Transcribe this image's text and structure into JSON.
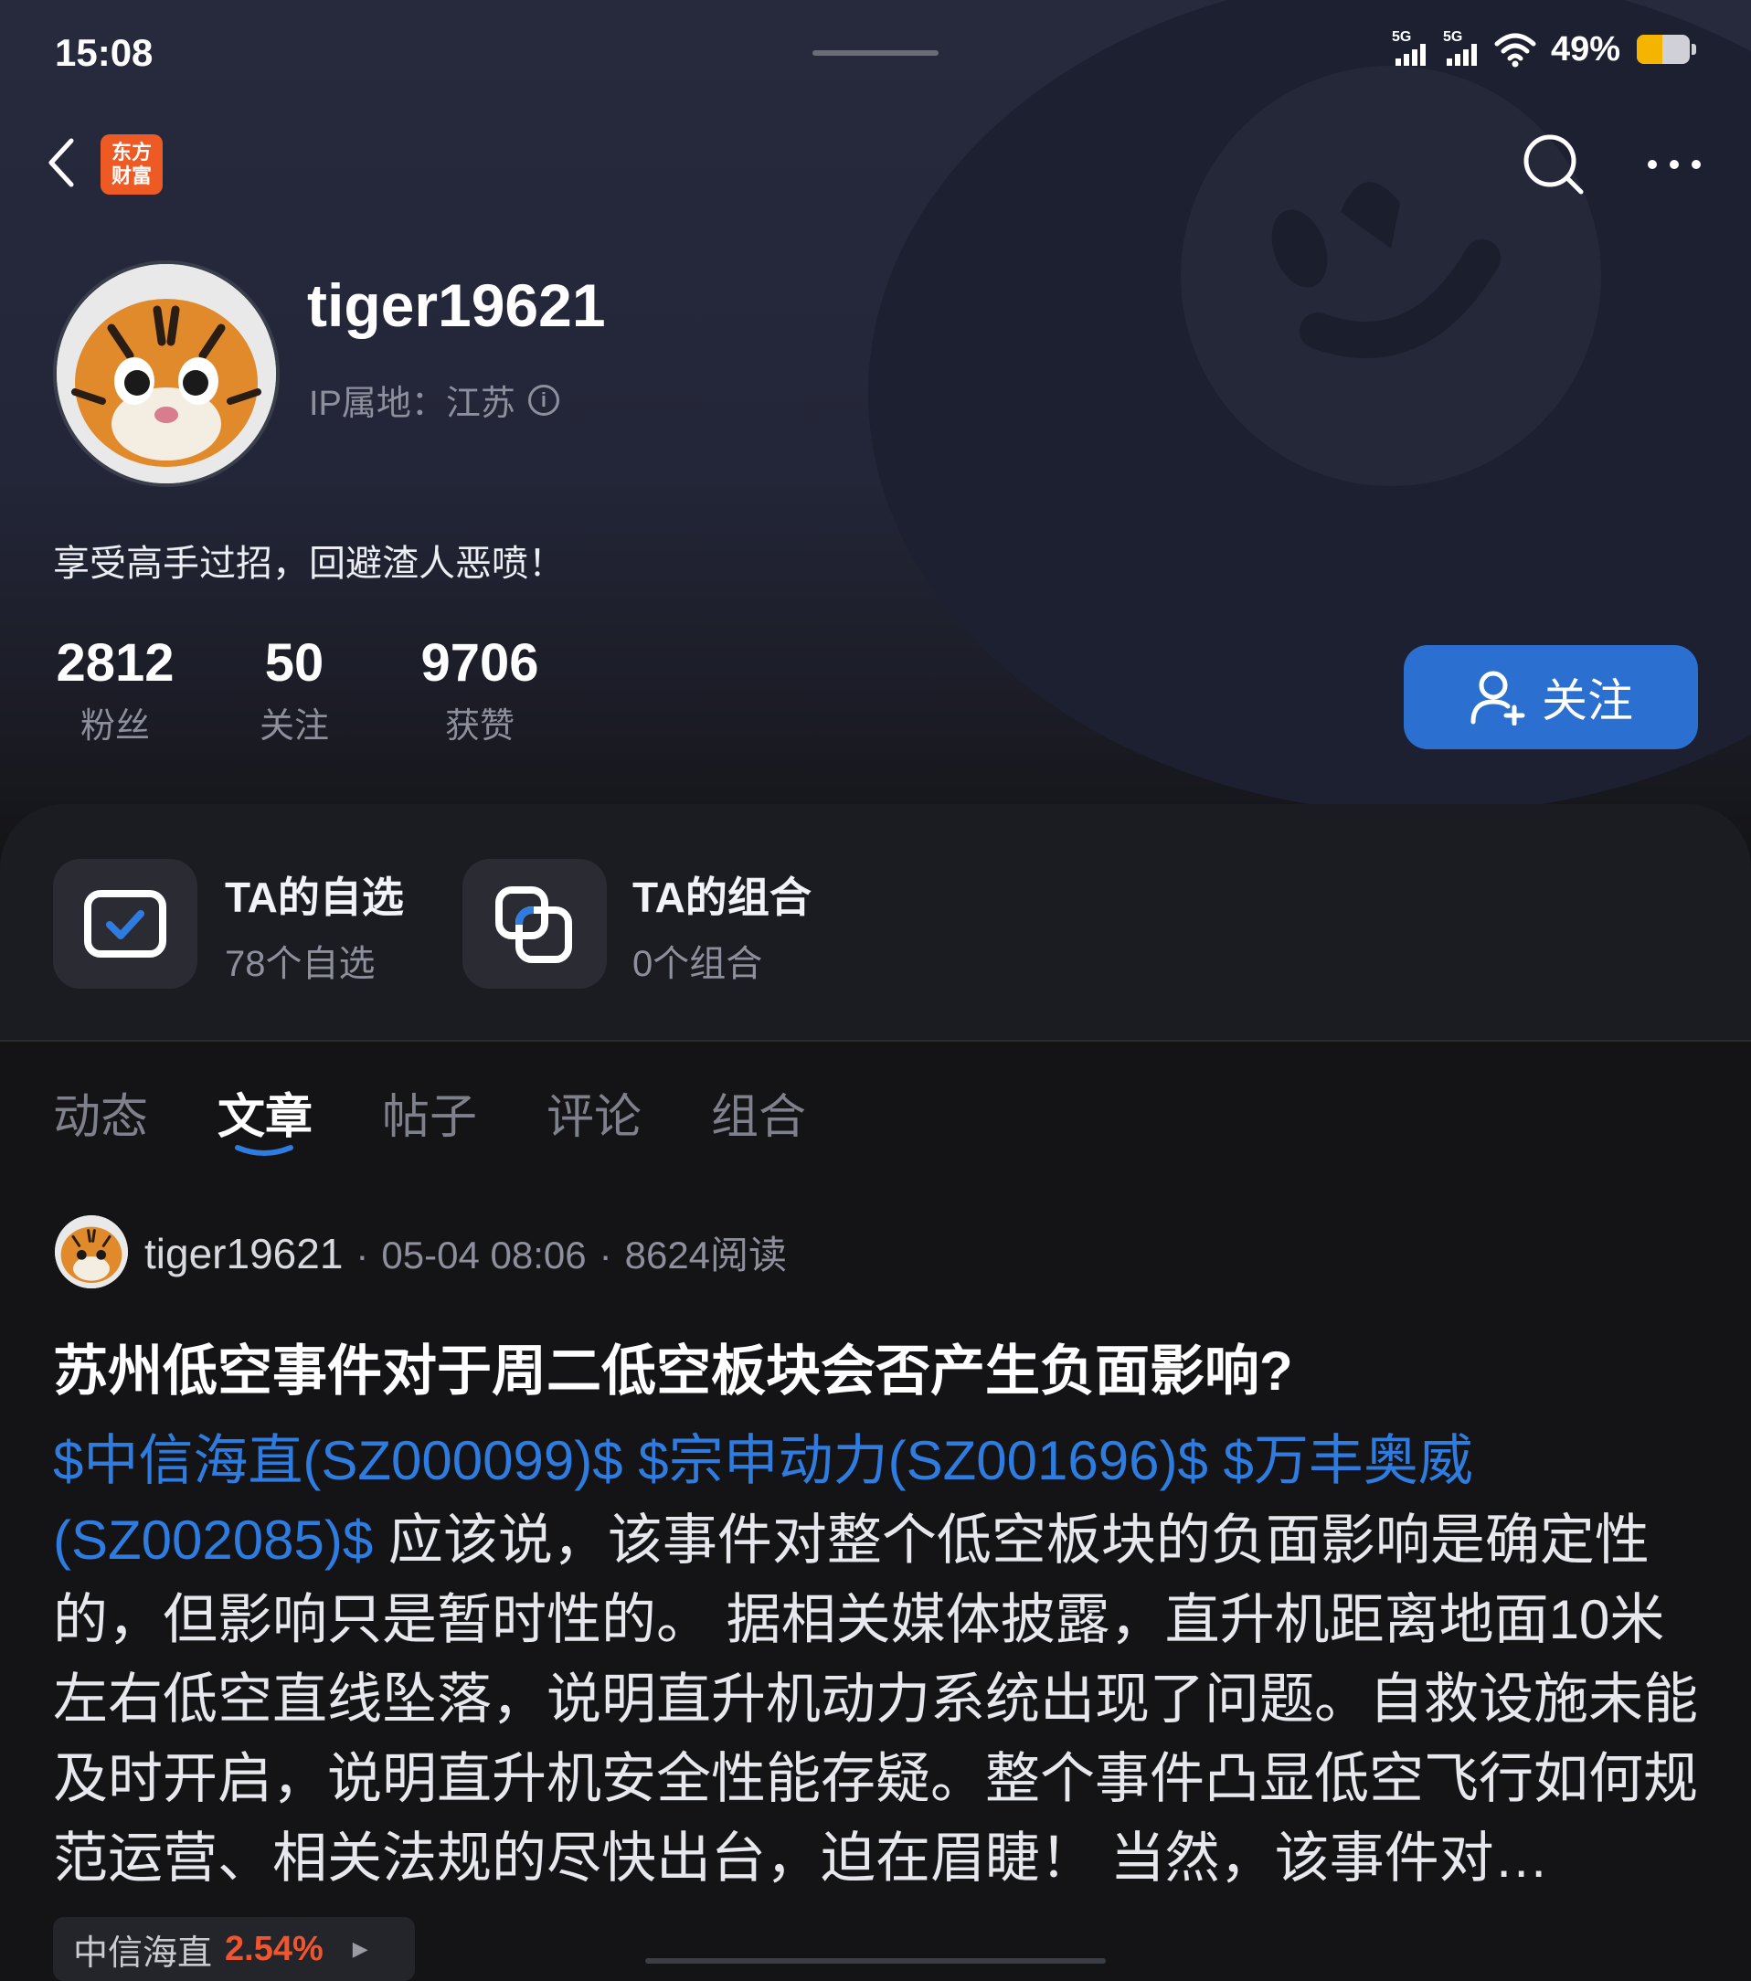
{
  "status_bar": {
    "time": "15:08",
    "signal_label": "5G",
    "battery_percent": "49%",
    "battery_level": 0.49
  },
  "nav": {
    "logo_line1": "东方",
    "logo_line2": "财富",
    "back_icon": "chevron-left-icon",
    "search_icon": "search-icon",
    "more_icon": "more-icon"
  },
  "profile": {
    "username": "tiger19621",
    "ip_location": "IP属地：江苏",
    "bio": "享受高手过招，回避渣人恶喷！",
    "stats": [
      {
        "value": "2812",
        "label": "粉丝"
      },
      {
        "value": "50",
        "label": "关注"
      },
      {
        "value": "9706",
        "label": "获赞"
      }
    ],
    "follow_button": "关注"
  },
  "quick_cards": [
    {
      "title": "TA的自选",
      "subtitle": "78个自选",
      "icon": "watchlist-check-icon"
    },
    {
      "title": "TA的组合",
      "subtitle": "0个组合",
      "icon": "portfolio-icon"
    }
  ],
  "tabs": [
    {
      "label": "动态",
      "active": false
    },
    {
      "label": "文章",
      "active": true
    },
    {
      "label": "帖子",
      "active": false
    },
    {
      "label": "评论",
      "active": false
    },
    {
      "label": "组合",
      "active": false
    }
  ],
  "post": {
    "author": "tiger19621",
    "time": "05-04 08:06",
    "reads": "8624阅读",
    "title": "苏州低空事件对于周二低空板块会否产生负面影响?",
    "stock_links": [
      "$中信海直(SZ000099)$",
      "$宗申动力(SZ001696)$",
      "$万丰奥威(SZ002085)$"
    ],
    "body": "应该说，该事件对整个低空板块的负面影响是确定性的，但影响只是暂时性的。 据相关媒体披露，直升机距离地面10米左右低空直线坠落，说明直升机动力系统出现了问题。自救设施未能及时开启，说明直升机安全性能存疑。整个事件凸显低空飞行如何规范运营、相关法规的尽快出台，迫在眉睫！ 当然，该事件对…",
    "stock_tag": {
      "name": "中信海直",
      "change": "2.54%"
    }
  },
  "colors": {
    "accent": "#2b6fd0",
    "link": "#2e7ce0",
    "up": "#f0552e",
    "logo": "#ee5a24"
  }
}
